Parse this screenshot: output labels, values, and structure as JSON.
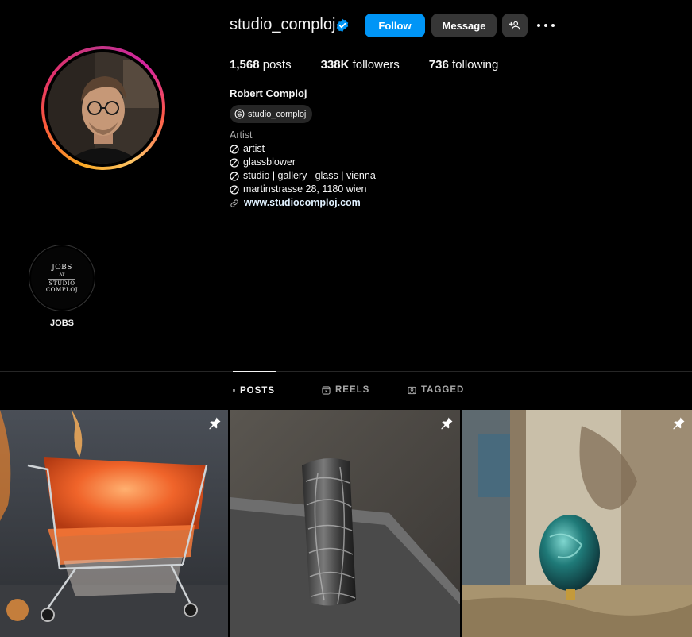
{
  "profile": {
    "username": "studio_comploj",
    "verified": true,
    "follow_label": "Follow",
    "message_label": "Message",
    "stats": {
      "posts_count": "1,568",
      "posts_label": "posts",
      "followers_count": "338K",
      "followers_label": "followers",
      "following_count": "736",
      "following_label": "following"
    },
    "full_name": "Robert Comploj",
    "threads_handle": "studio_comploj",
    "category": "Artist",
    "bio_lines": [
      "artist",
      "glassblower",
      "studio | gallery | glass | vienna",
      "martinstrasse 28, 1180 wien"
    ],
    "website": "www.studiocomploj.com"
  },
  "highlights": [
    {
      "label": "JOBS",
      "cover_text": [
        "JOBS",
        "AT",
        "STUDIO",
        "COMPLOJ"
      ]
    }
  ],
  "tabs": [
    {
      "label": "POSTS",
      "icon": "grid-icon",
      "active": true
    },
    {
      "label": "REELS",
      "icon": "reels-icon",
      "active": false
    },
    {
      "label": "TAGGED",
      "icon": "tagged-icon",
      "active": false
    }
  ],
  "posts": [
    {
      "subject": "glass-shopping-cart",
      "pinned": true
    },
    {
      "subject": "dark-glass-vase",
      "pinned": true
    },
    {
      "subject": "teal-glass-egg",
      "pinned": true
    }
  ],
  "colors": {
    "background": "#000000",
    "follow_button": "#0095f6",
    "secondary_button": "#363636",
    "verified_badge": "#0095f6",
    "muted_text": "#a8a8a8",
    "link_text": "#e0f1ff"
  }
}
